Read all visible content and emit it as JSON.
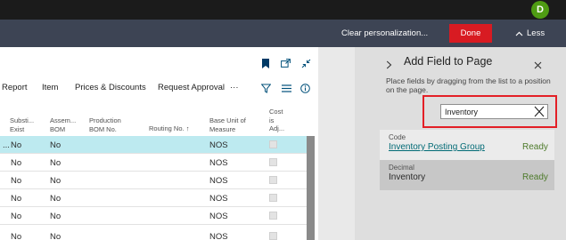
{
  "topbar": {
    "icons": [
      "search-icon",
      "bell-icon",
      "settings-icon",
      "help-icon"
    ],
    "help_label": "?",
    "user_initial": "D"
  },
  "personalization": {
    "clear_label": "Clear personalization...",
    "done_label": "Done",
    "less_label": "Less",
    "colors": {
      "bar": "#3d4454",
      "done": "#d81b22"
    }
  },
  "page": {
    "icons": [
      "bookmark-icon",
      "open-in-new-window-icon",
      "collapse-icon"
    ],
    "actions": [
      "Report",
      "Item",
      "Prices & Discounts",
      "Request Approval",
      "···"
    ],
    "action_icons": [
      "filter-icon",
      "list-view-icon",
      "info-icon"
    ],
    "columns": [
      {
        "line1": "Substi...",
        "line2": "Exist"
      },
      {
        "line1": "Assem...",
        "line2": "BOM"
      },
      {
        "line1": "Production",
        "line2": "BOM No."
      },
      {
        "line1": "Routing No. ↑",
        "line2": ""
      },
      {
        "line1": "Base Unit of",
        "line2": "Measure"
      },
      {
        "line1": "Cost",
        "line2": "is",
        "line3": "Adj..."
      }
    ],
    "rows": [
      {
        "lead": "...",
        "substitutes": "No",
        "assembly": "No",
        "uom": "NOS",
        "selected": true
      },
      {
        "lead": "",
        "substitutes": "No",
        "assembly": "No",
        "uom": "NOS",
        "selected": false
      },
      {
        "lead": "",
        "substitutes": "No",
        "assembly": "No",
        "uom": "NOS",
        "selected": false
      },
      {
        "lead": "",
        "substitutes": "No",
        "assembly": "No",
        "uom": "NOS",
        "selected": false
      },
      {
        "lead": "",
        "substitutes": "No",
        "assembly": "No",
        "uom": "NOS",
        "selected": false
      },
      {
        "lead": "",
        "substitutes": "No",
        "assembly": "No",
        "uom": "NOS",
        "selected": false
      }
    ]
  },
  "pane": {
    "title": "Add Field to Page",
    "description": "Place fields by dragging from the list to a position on the page.",
    "search": {
      "value": "Inventory"
    },
    "fields": [
      {
        "type": "Code",
        "name": "Inventory Posting Group",
        "status": "Ready"
      },
      {
        "type": "Decimal",
        "name": "Inventory",
        "status": "Ready"
      }
    ],
    "colors": {
      "highlight": "#e31f26",
      "ready": "#4d7a2a"
    }
  }
}
